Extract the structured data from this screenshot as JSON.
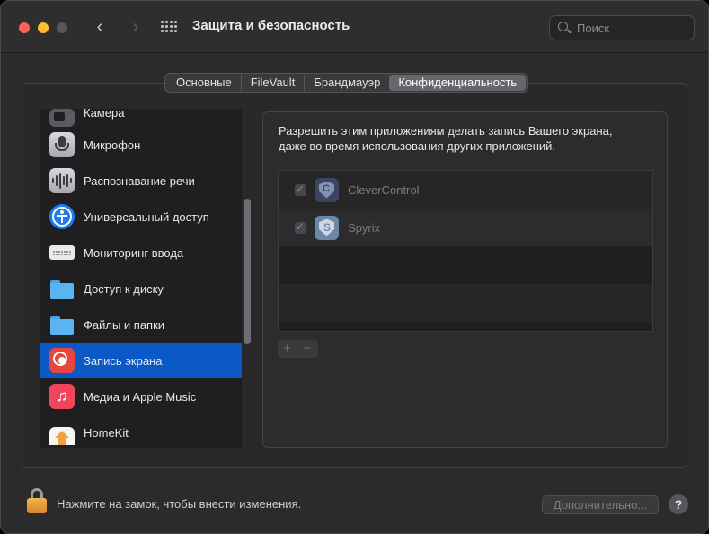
{
  "window": {
    "title": "Защита и безопасность",
    "search_placeholder": "Поиск"
  },
  "tabs": [
    {
      "label": "Основные",
      "active": false
    },
    {
      "label": "FileVault",
      "active": false
    },
    {
      "label": "Брандмауэр",
      "active": false
    },
    {
      "label": "Конфиденциальность",
      "active": true
    }
  ],
  "sidebar": {
    "items": [
      {
        "label": "Камера",
        "icon": "camera-icon"
      },
      {
        "label": "Микрофон",
        "icon": "microphone-icon"
      },
      {
        "label": "Распознавание речи",
        "icon": "speech-recognition-icon"
      },
      {
        "label": "Универсальный доступ",
        "icon": "accessibility-icon"
      },
      {
        "label": "Мониторинг ввода",
        "icon": "keyboard-icon"
      },
      {
        "label": "Доступ к диску",
        "icon": "folder-icon"
      },
      {
        "label": "Файлы и папки",
        "icon": "folder-icon"
      },
      {
        "label": "Запись экрана",
        "icon": "screen-recording-icon",
        "selected": true
      },
      {
        "label": "Медиа и Apple Music",
        "icon": "music-icon"
      },
      {
        "label": "HomeKit",
        "icon": "home-icon"
      }
    ]
  },
  "detail": {
    "description_line1": "Разрешить этим приложениям делать запись Вашего экрана,",
    "description_line2": "даже во время использования других приложений.",
    "apps": [
      {
        "name": "CleverControl",
        "checked": true,
        "icon": "clevercontrol-icon"
      },
      {
        "name": "Spyrix",
        "checked": true,
        "icon": "spyrix-icon"
      }
    ],
    "add_label": "+",
    "remove_label": "−"
  },
  "footer": {
    "lock_text": "Нажмите на замок, чтобы внести изменения.",
    "advanced_label": "Дополнительно...",
    "help_label": "?"
  },
  "colors": {
    "selection": "#0a59c7",
    "close": "#fe5f57",
    "minimize": "#febc2e"
  }
}
